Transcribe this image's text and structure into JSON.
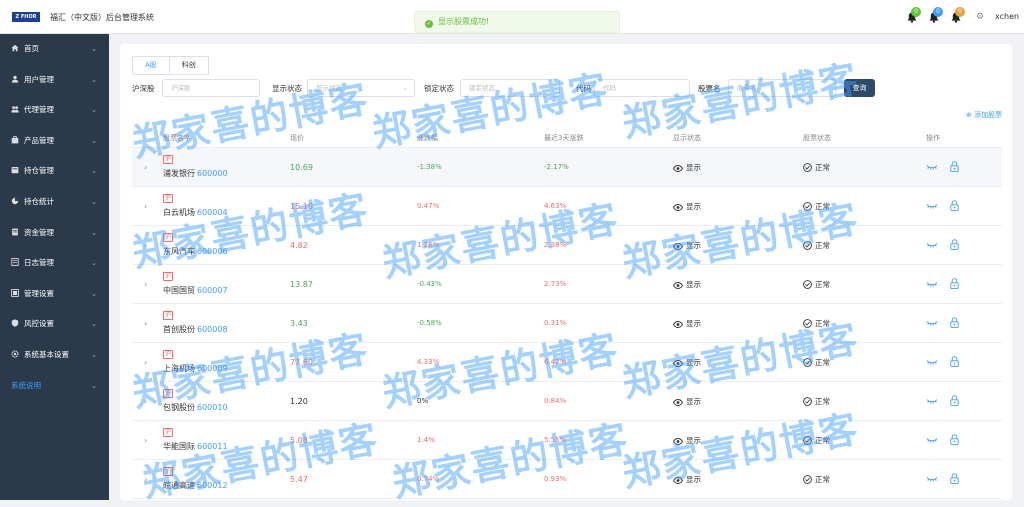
{
  "header": {
    "logo_text": "Z FHOR",
    "title": "福汇（中文版）后台管理系统",
    "toast": "显示股票成功!",
    "badges": [
      {
        "count": "0",
        "color": "#67c23a"
      },
      {
        "count": "0",
        "color": "#409eff"
      },
      {
        "count": "0",
        "color": "#e6a23c"
      }
    ],
    "username": "xchen"
  },
  "sidebar": {
    "items": [
      {
        "label": "首页",
        "icon": "home-icon"
      },
      {
        "label": "用户管理",
        "icon": "user-icon"
      },
      {
        "label": "代理管理",
        "icon": "agent-icon"
      },
      {
        "label": "产品管理",
        "icon": "product-icon"
      },
      {
        "label": "持仓管理",
        "icon": "position-icon"
      },
      {
        "label": "持仓统计",
        "icon": "stats-icon"
      },
      {
        "label": "资金管理",
        "icon": "money-icon"
      },
      {
        "label": "日志管理",
        "icon": "log-icon"
      },
      {
        "label": "管理设置",
        "icon": "admin-icon"
      },
      {
        "label": "风控设置",
        "icon": "risk-icon"
      },
      {
        "label": "系统基本设置",
        "icon": "gear-icon"
      },
      {
        "label": "系统说明",
        "icon": ""
      }
    ]
  },
  "tabs": [
    "A股",
    "科创"
  ],
  "filters": {
    "market_label": "沪深股",
    "market_placeholder": "沪深股",
    "display_label": "显示状态",
    "display_placeholder": "显示状态",
    "lock_label": "锁定状态",
    "lock_placeholder": "锁定状态",
    "code_label": "代码",
    "code_placeholder": "代码",
    "name_label": "股票名",
    "name_placeholder": "股票名",
    "query_button": "查询"
  },
  "add_stock": "⊕ 添加股票",
  "table": {
    "headers": [
      "股票名字",
      "现价",
      "涨跌幅",
      "最近3天涨跌",
      "显示状态",
      "股票状态",
      "操作"
    ],
    "rows": [
      {
        "tag": "沪",
        "name": "浦发银行",
        "code": "600000",
        "price": "10.69",
        "chg": "-1.38%",
        "chg3": "-2.17%",
        "display": "显示",
        "status": "正常",
        "dir": "down",
        "dir3": "down"
      },
      {
        "tag": "沪",
        "name": "白云机场",
        "code": "600004",
        "price": "15.10",
        "chg": "0.47%",
        "chg3": "4.63%",
        "display": "显示",
        "status": "正常",
        "dir": "up",
        "dir3": "up"
      },
      {
        "tag": "沪",
        "name": "东风汽车",
        "code": "600006",
        "price": "4.82",
        "chg": "1.26%",
        "chg3": "2.38%",
        "display": "显示",
        "status": "正常",
        "dir": "up",
        "dir3": "up"
      },
      {
        "tag": "沪",
        "name": "中国国贸",
        "code": "600007",
        "price": "13.87",
        "chg": "-0.43%",
        "chg3": "2.73%",
        "display": "显示",
        "status": "正常",
        "dir": "down",
        "dir3": "up"
      },
      {
        "tag": "沪",
        "name": "首创股份",
        "code": "600008",
        "price": "3.43",
        "chg": "-0.58%",
        "chg3": "0.31%",
        "display": "显示",
        "status": "正常",
        "dir": "down",
        "dir3": "up"
      },
      {
        "tag": "沪",
        "name": "上海机场",
        "code": "600009",
        "price": "77.60",
        "chg": "4.33%",
        "chg3": "6.42%",
        "display": "显示",
        "status": "正常",
        "dir": "up",
        "dir3": "up"
      },
      {
        "tag": "沪",
        "name": "包钢股份",
        "code": "600010",
        "price": "1.20",
        "chg": "0%",
        "chg3": "0.84%",
        "display": "显示",
        "status": "正常",
        "dir": "flat",
        "dir3": "up"
      },
      {
        "tag": "沪",
        "name": "华能国际",
        "code": "600011",
        "price": "5.08",
        "chg": "1.4%",
        "chg3": "5.55%",
        "display": "显示",
        "status": "正常",
        "dir": "up",
        "dir3": "up"
      },
      {
        "tag": "沪",
        "name": "皖通高速",
        "code": "600012",
        "price": "5.47",
        "chg": "0.74%",
        "chg3": "0.93%",
        "display": "显示",
        "status": "正常",
        "dir": "up",
        "dir3": "up"
      }
    ]
  },
  "watermark": "郑家喜的博客"
}
